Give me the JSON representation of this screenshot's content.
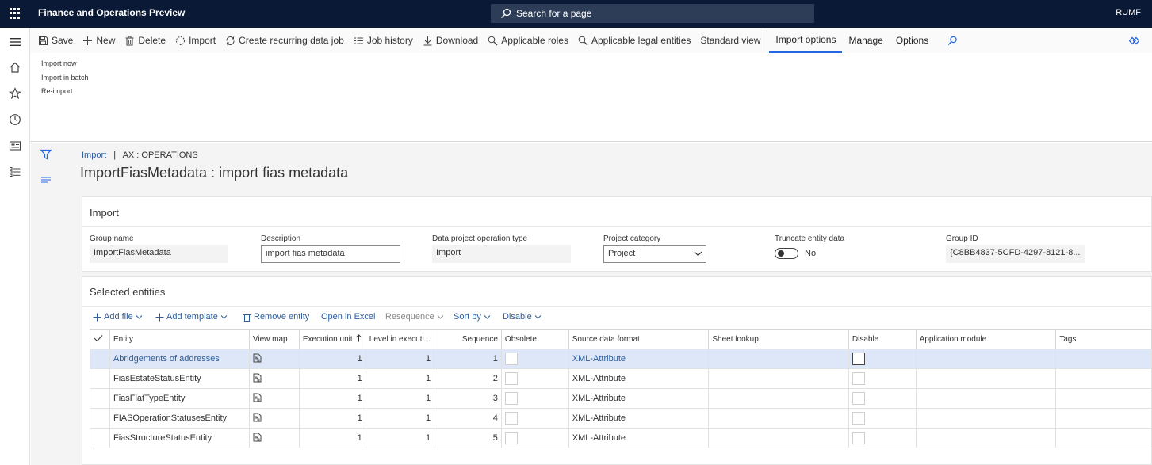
{
  "app": {
    "title": "Finance and Operations Preview",
    "company": "RUMF"
  },
  "search": {
    "placeholder": "Search for a page"
  },
  "actionpane": {
    "items": [
      {
        "label": "Save"
      },
      {
        "label": "New"
      },
      {
        "label": "Delete"
      },
      {
        "label": "Import"
      },
      {
        "label": "Create recurring data job"
      },
      {
        "label": "Job history"
      },
      {
        "label": "Download"
      },
      {
        "label": "Applicable roles"
      },
      {
        "label": "Applicable legal entities"
      },
      {
        "label": "Standard view"
      }
    ],
    "tabs": [
      {
        "label": "Import options",
        "active": true
      },
      {
        "label": "Manage"
      },
      {
        "label": "Options"
      }
    ]
  },
  "import_menu": {
    "items": [
      {
        "label": "Import now"
      },
      {
        "label": "Import in batch"
      },
      {
        "label": "Re-import"
      }
    ]
  },
  "breadcrumb": {
    "link": "Import",
    "separator": "|",
    "context": "AX : OPERATIONS"
  },
  "page": {
    "title": "ImportFiasMetadata : import fias metadata"
  },
  "import_card": {
    "header": "Import",
    "fields": {
      "group_name": {
        "label": "Group name",
        "value": "ImportFiasMetadata"
      },
      "description": {
        "label": "Description",
        "value": "import fias metadata"
      },
      "operation_type": {
        "label": "Data project operation type",
        "value": "Import"
      },
      "project_category": {
        "label": "Project category",
        "value": "Project"
      },
      "truncate": {
        "label": "Truncate entity data",
        "value": "No"
      },
      "group_id": {
        "label": "Group ID",
        "value": "{C8BB4837-5CFD-4297-8121-8..."
      }
    }
  },
  "entities": {
    "header": "Selected entities",
    "toolbar": {
      "add_file": "Add file",
      "add_template": "Add template",
      "remove_entity": "Remove entity",
      "open_in_excel": "Open in Excel",
      "resequence": "Resequence",
      "sort_by": "Sort by",
      "disable": "Disable"
    },
    "columns": {
      "entity": "Entity",
      "view_map": "View map",
      "execution_unit": "Execution unit",
      "level": "Level in executi...",
      "sequence": "Sequence",
      "obsolete": "Obsolete",
      "source_format": "Source data format",
      "sheet_lookup": "Sheet lookup",
      "disable": "Disable",
      "app_module": "Application module",
      "tags": "Tags"
    },
    "rows": [
      {
        "entity": "Abridgements of addresses",
        "execution_unit": "1",
        "level": "1",
        "sequence": "1",
        "format": "XML-Attribute"
      },
      {
        "entity": "FiasEstateStatusEntity",
        "execution_unit": "1",
        "level": "1",
        "sequence": "2",
        "format": "XML-Attribute"
      },
      {
        "entity": "FiasFlatTypeEntity",
        "execution_unit": "1",
        "level": "1",
        "sequence": "3",
        "format": "XML-Attribute"
      },
      {
        "entity": "FIASOperationStatusesEntity",
        "execution_unit": "1",
        "level": "1",
        "sequence": "4",
        "format": "XML-Attribute"
      },
      {
        "entity": "FiasStructureStatusEntity",
        "execution_unit": "1",
        "level": "1",
        "sequence": "5",
        "format": "XML-Attribute"
      }
    ]
  },
  "colors": {
    "topbar": "#0a1a36",
    "accent": "#2266e3",
    "link": "#2e5d9b",
    "selected_row": "#dde7f7"
  }
}
